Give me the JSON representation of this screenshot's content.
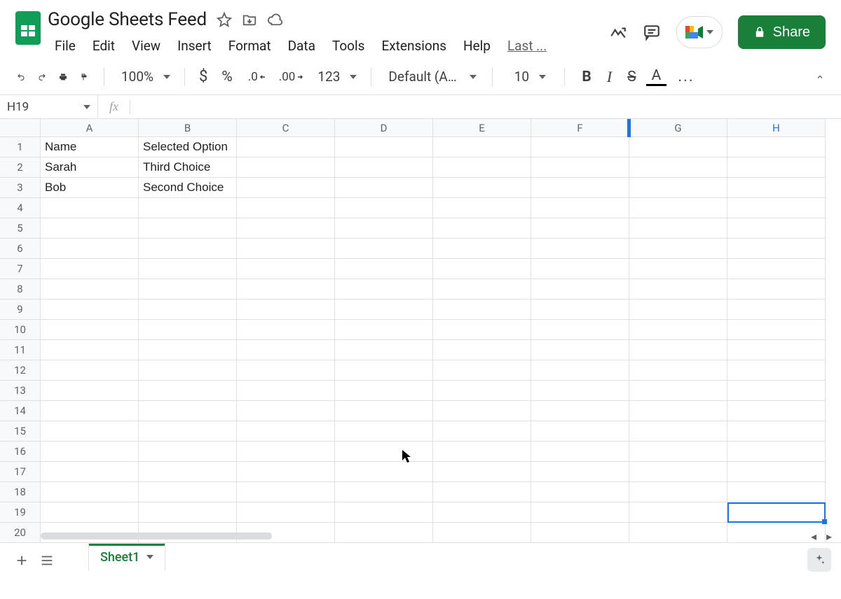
{
  "doc": {
    "title": "Google Sheets Feed"
  },
  "menus": [
    "File",
    "Edit",
    "View",
    "Insert",
    "Format",
    "Data",
    "Tools",
    "Extensions",
    "Help",
    "Last ..."
  ],
  "share": {
    "label": "Share"
  },
  "toolbar": {
    "zoom": "100%",
    "currency": "$",
    "percent": "%",
    "dec_dec": ".0",
    "inc_dec": ".00",
    "num_fmt": "123",
    "font": "Default (Ari...",
    "font_size": "10",
    "more": "..."
  },
  "namebox": "H19",
  "columns": [
    "A",
    "B",
    "C",
    "D",
    "E",
    "F",
    "G",
    "H"
  ],
  "rows": 20,
  "active_cell": {
    "row": 19,
    "col": "H"
  },
  "highlight_col_edge": "G-H",
  "cells": {
    "A1": "Name",
    "B1": "Selected Option",
    "A2": "Sarah",
    "B2": "Third Choice",
    "A3": "Bob",
    "B3": "Second Choice"
  },
  "sheet_tab": "Sheet1"
}
